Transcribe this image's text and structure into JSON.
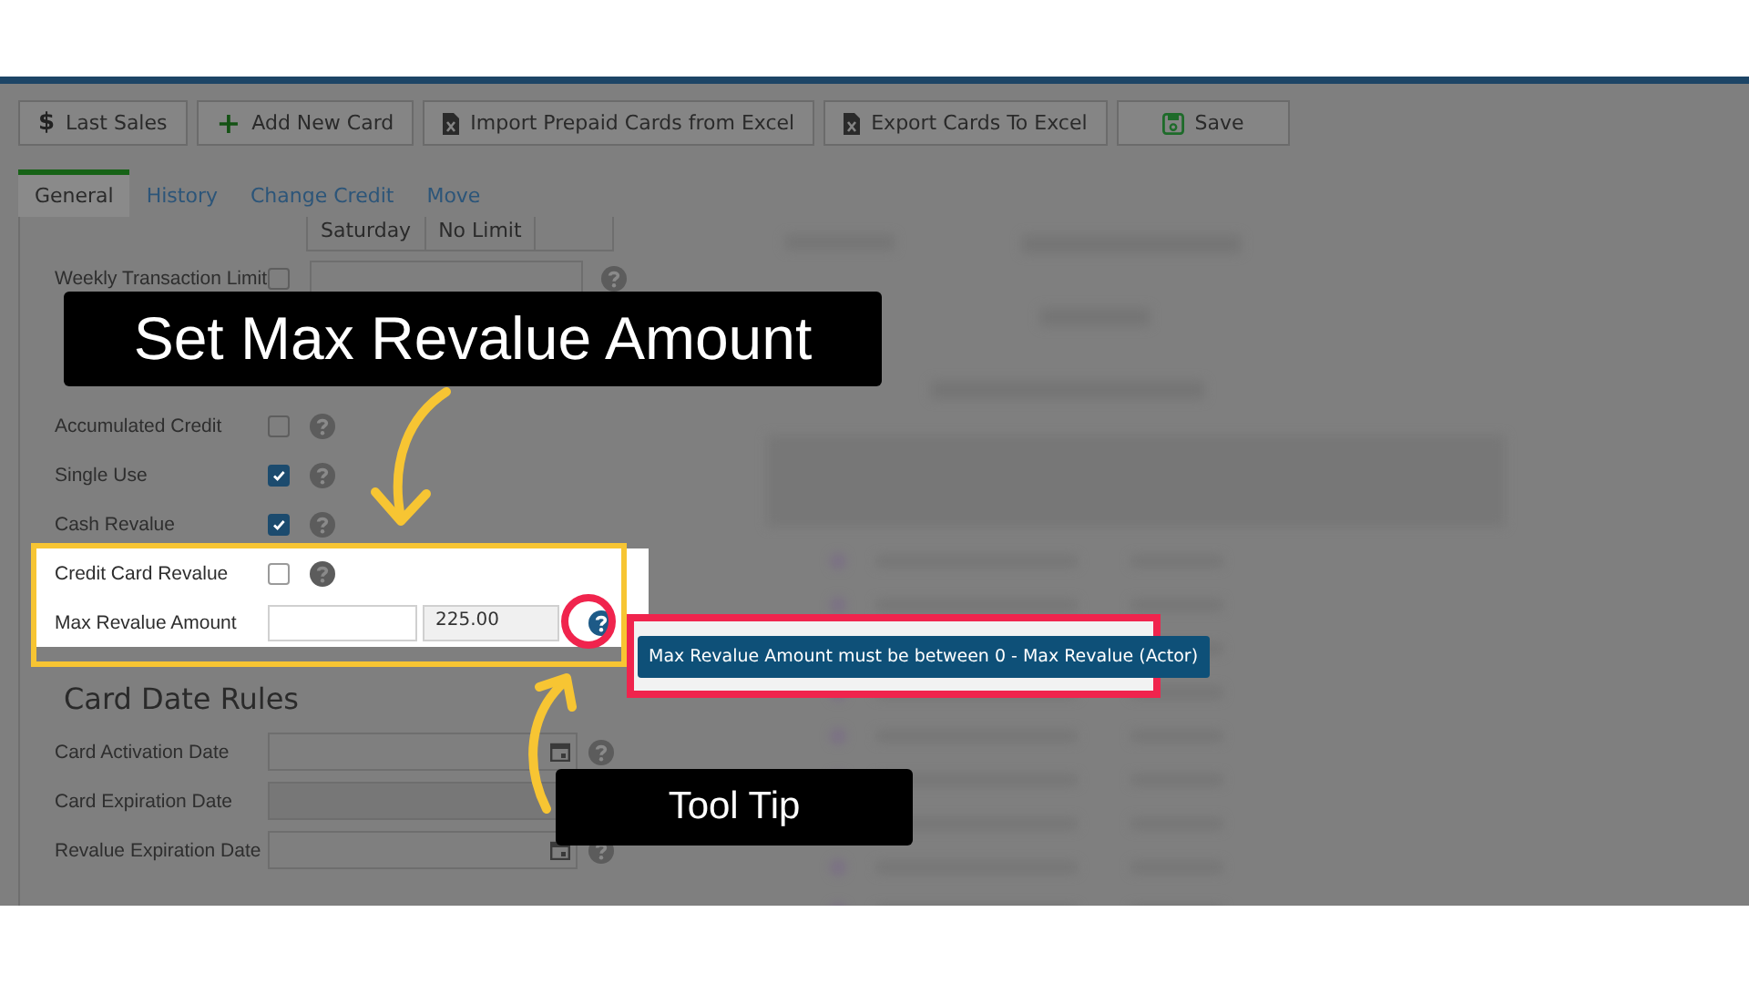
{
  "toolbar": [
    {
      "label": "Last Sales",
      "glyph": "$",
      "kind": "glyph"
    },
    {
      "label": "Add New Card",
      "glyph": "+",
      "kind": "glyph"
    },
    {
      "label": "Import Prepaid Cards from Excel",
      "kind": "file"
    },
    {
      "label": "Export Cards To Excel",
      "kind": "file"
    },
    {
      "label": "Save",
      "kind": "save"
    }
  ],
  "tabs": [
    {
      "label": "General",
      "selected": true
    },
    {
      "label": "History",
      "selected": false
    },
    {
      "label": "Change Credit",
      "selected": false
    },
    {
      "label": "Move",
      "selected": false
    }
  ],
  "schedule_row": {
    "day": "Saturday",
    "limit": "No Limit"
  },
  "limit_rows": [
    {
      "label": "Weekly Transaction Limit",
      "kind": "check-field",
      "checked": false,
      "highlighted": false
    },
    {
      "label": "Accumulated Credit",
      "kind": "check",
      "checked": false,
      "highlighted": false
    },
    {
      "label": "Single Use",
      "kind": "check",
      "checked": true,
      "highlighted": false
    },
    {
      "label": "Cash Revalue",
      "kind": "check",
      "checked": true,
      "highlighted": false
    },
    {
      "label": "Credit Card Revalue",
      "kind": "check",
      "checked": false,
      "highlighted": true
    },
    {
      "label": "Max Revalue Amount",
      "kind": "amount",
      "value": "225.00",
      "highlighted": true
    }
  ],
  "date_rules": {
    "title": "Card Date Rules",
    "rows": [
      {
        "label": "Card Activation Date",
        "disabled": false
      },
      {
        "label": "Card Expiration Date",
        "disabled": true
      },
      {
        "label": "Revalue Expiration Date",
        "disabled": false
      }
    ]
  },
  "tooltip": {
    "text": "Max Revalue Amount must be between 0 - Max Revalue (Actor)"
  },
  "callouts": [
    {
      "kind": "title",
      "text": "Set Max Revalue Amount"
    },
    {
      "kind": "label",
      "text": "Tool Tip"
    }
  ]
}
